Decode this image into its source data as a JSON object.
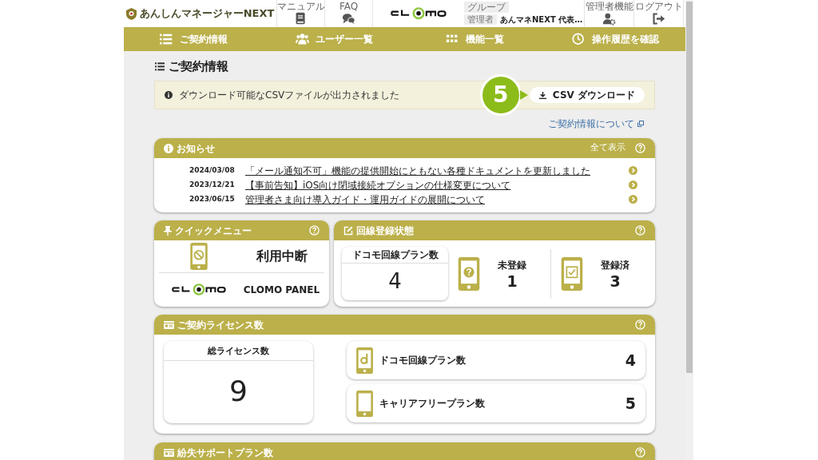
{
  "header": {
    "logo": "あんしんマネージャーNEXT",
    "links": [
      {
        "label": "マニュアル",
        "kind": "book"
      },
      {
        "label": "FAQ",
        "kind": "chat"
      }
    ],
    "group_label": "グループ",
    "admin_label": "管理者",
    "admin_name": "あんマネNEXT 代表…",
    "actions": [
      {
        "label": "管理者機能",
        "kind": "usergear"
      },
      {
        "label": "ログアウト",
        "kind": "logout"
      }
    ]
  },
  "nav": [
    {
      "label": "ご契約情報",
      "kind": "list"
    },
    {
      "label": "ユーザー一覧",
      "kind": "users"
    },
    {
      "label": "機能一覧",
      "kind": "grid"
    },
    {
      "label": "操作履歴を確認",
      "kind": "clock"
    }
  ],
  "page_title": "ご契約情報",
  "notice": {
    "message": "ダウンロード可能なCSVファイルが出力されました",
    "step": "5",
    "button": "CSV ダウンロード"
  },
  "about_link": "ご契約情報について",
  "news": {
    "title": "お知らせ",
    "show_all": "全て表示",
    "items": [
      {
        "date": "2024/03/08",
        "text": "「メール通知不可」機能の提供開始にともない各種ドキュメントを更新しました"
      },
      {
        "date": "2023/12/21",
        "text": "【事前告知】iOS向け閉域接続オプションの仕様変更について"
      },
      {
        "date": "2023/06/15",
        "text": "管理者さま向け導入ガイド・運用ガイドの展開について"
      }
    ]
  },
  "quick_menu": {
    "title": "クイックメニュー",
    "items": [
      {
        "kind": "suspend",
        "label": "利用中断"
      },
      {
        "kind": "clomo",
        "label": "CLOMO PANEL"
      }
    ]
  },
  "line_status": {
    "title": "回線登録状態",
    "total_label": "ドコモ回線プラン数",
    "total": "4",
    "items": [
      {
        "kind": "question",
        "label": "未登録",
        "value": "1"
      },
      {
        "kind": "check",
        "label": "登録済",
        "value": "3"
      }
    ]
  },
  "licenses": {
    "title": "ご契約ライセンス数",
    "total_label": "総ライセンス数",
    "total": "9",
    "items": [
      {
        "kind": "docomo",
        "label": "ドコモ回線プラン数",
        "value": "4"
      },
      {
        "kind": "phone",
        "label": "キャリアフリープラン数",
        "value": "5"
      }
    ]
  },
  "lost_support": {
    "title": "紛失サポートプラン数"
  }
}
